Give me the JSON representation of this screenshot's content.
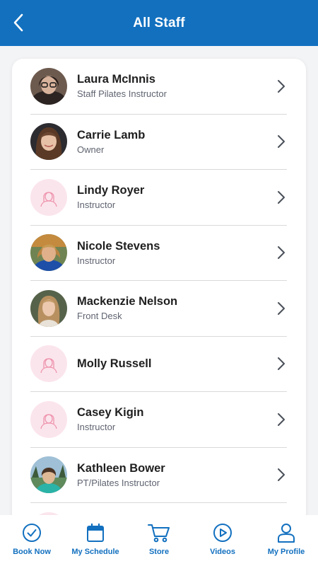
{
  "header": {
    "title": "All Staff"
  },
  "colors": {
    "brand": "#1270bf",
    "placeholder_bg": "#fbe5ec",
    "placeholder_icon": "#ee93ad"
  },
  "staff": [
    {
      "name": "Laura McInnis",
      "role": "Staff Pilates Instructor",
      "avatar": "photo"
    },
    {
      "name": "Carrie Lamb",
      "role": "Owner",
      "avatar": "photo"
    },
    {
      "name": "Lindy Royer",
      "role": "Instructor",
      "avatar": "placeholder"
    },
    {
      "name": "Nicole Stevens",
      "role": "Instructor",
      "avatar": "photo"
    },
    {
      "name": "Mackenzie Nelson",
      "role": "Front Desk",
      "avatar": "photo"
    },
    {
      "name": "Molly Russell",
      "role": "",
      "avatar": "placeholder"
    },
    {
      "name": "Casey Kigin",
      "role": "Instructor",
      "avatar": "placeholder"
    },
    {
      "name": "Kathleen Bower",
      "role": "PT/Pilates Instructor",
      "avatar": "photo"
    }
  ],
  "tabs": [
    {
      "label": "Book Now",
      "icon": "check-circle-icon"
    },
    {
      "label": "My Schedule",
      "icon": "calendar-icon"
    },
    {
      "label": "Store",
      "icon": "cart-icon"
    },
    {
      "label": "Videos",
      "icon": "play-circle-icon"
    },
    {
      "label": "My Profile",
      "icon": "user-icon"
    }
  ]
}
